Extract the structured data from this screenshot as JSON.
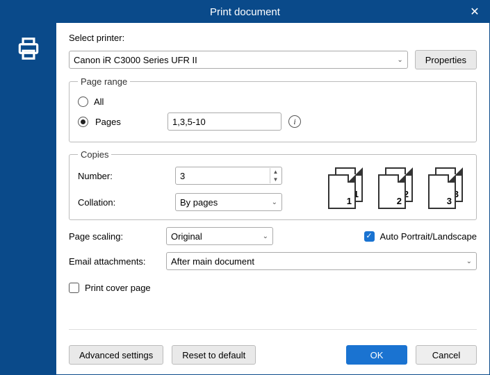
{
  "title": "Print document",
  "printer_section": {
    "label": "Select printer:",
    "selected": "Canon iR C3000 Series UFR II",
    "properties_btn": "Properties"
  },
  "page_range": {
    "legend": "Page range",
    "opt_all": "All",
    "opt_pages": "Pages",
    "selected": "pages",
    "pages_value": "1,3,5-10"
  },
  "copies": {
    "legend": "Copies",
    "number_label": "Number:",
    "number_value": "3",
    "collation_label": "Collation:",
    "collation_value": "By pages"
  },
  "scaling": {
    "label": "Page scaling:",
    "value": "Original",
    "auto_orient_label": "Auto Portrait/Landscape",
    "auto_orient_checked": true
  },
  "attachments": {
    "label": "Email attachments:",
    "value": "After main document"
  },
  "cover": {
    "label": "Print cover page",
    "checked": false
  },
  "footer": {
    "advanced": "Advanced settings",
    "reset": "Reset to default",
    "ok": "OK",
    "cancel": "Cancel"
  }
}
